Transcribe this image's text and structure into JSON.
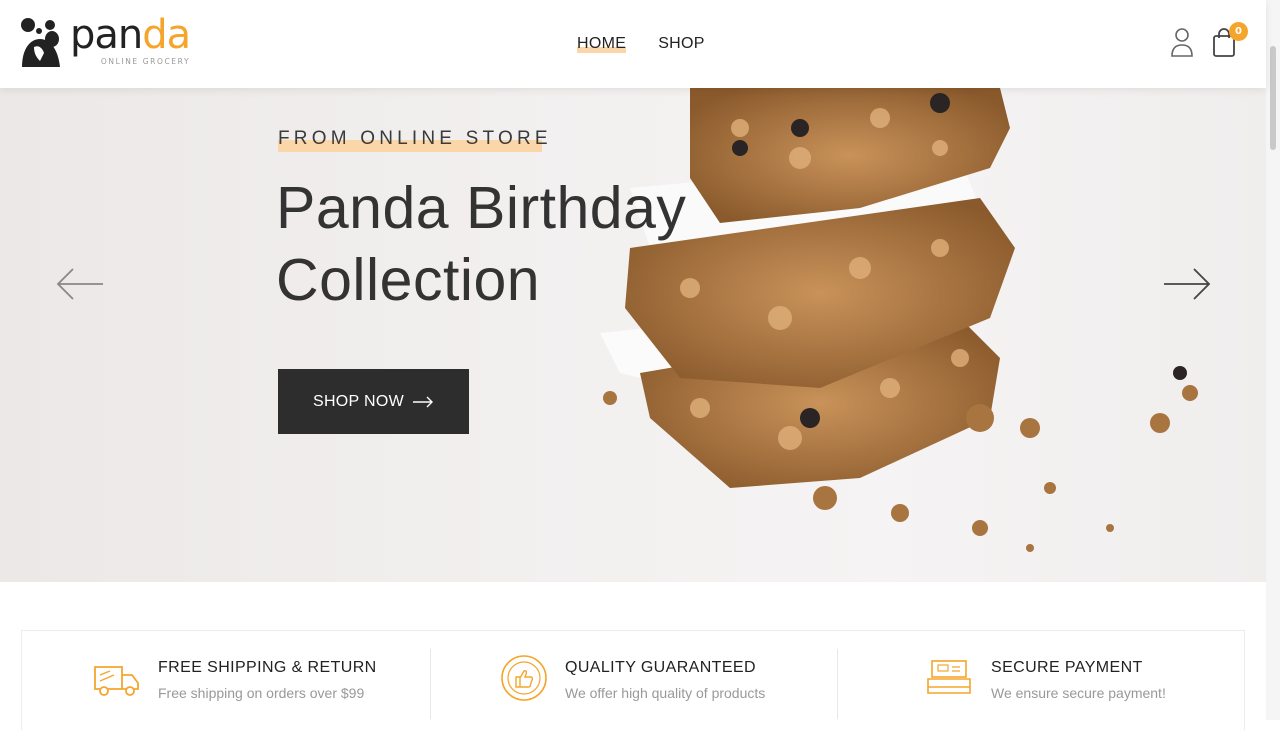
{
  "brand": {
    "name_main": "pan",
    "name_accent": "da",
    "tagline": "ONLINE GROCERY",
    "accent_color": "#f5a52b"
  },
  "nav": {
    "items": [
      {
        "label": "HOME",
        "active": true
      },
      {
        "label": "SHOP",
        "active": false
      }
    ]
  },
  "header_icons": {
    "account_icon": "user-icon",
    "cart_icon": "shopping-bag-icon",
    "cart_count": "0"
  },
  "hero": {
    "kicker": "FROM ONLINE STORE",
    "title_line1": "Panda Birthday",
    "title_line2": "Collection",
    "cta_label": "SHOP NOW",
    "prev_icon": "arrow-left-icon",
    "next_icon": "arrow-right-icon"
  },
  "features": [
    {
      "icon": "truck-icon",
      "title": "FREE SHIPPING & RETURN",
      "text": "Free shipping on orders over $99"
    },
    {
      "icon": "thumbs-up-badge-icon",
      "title": "QUALITY GUARANTEED",
      "text": "We offer high quality of products"
    },
    {
      "icon": "cash-register-icon",
      "title": "SECURE PAYMENT",
      "text": "We ensure secure payment!"
    }
  ]
}
